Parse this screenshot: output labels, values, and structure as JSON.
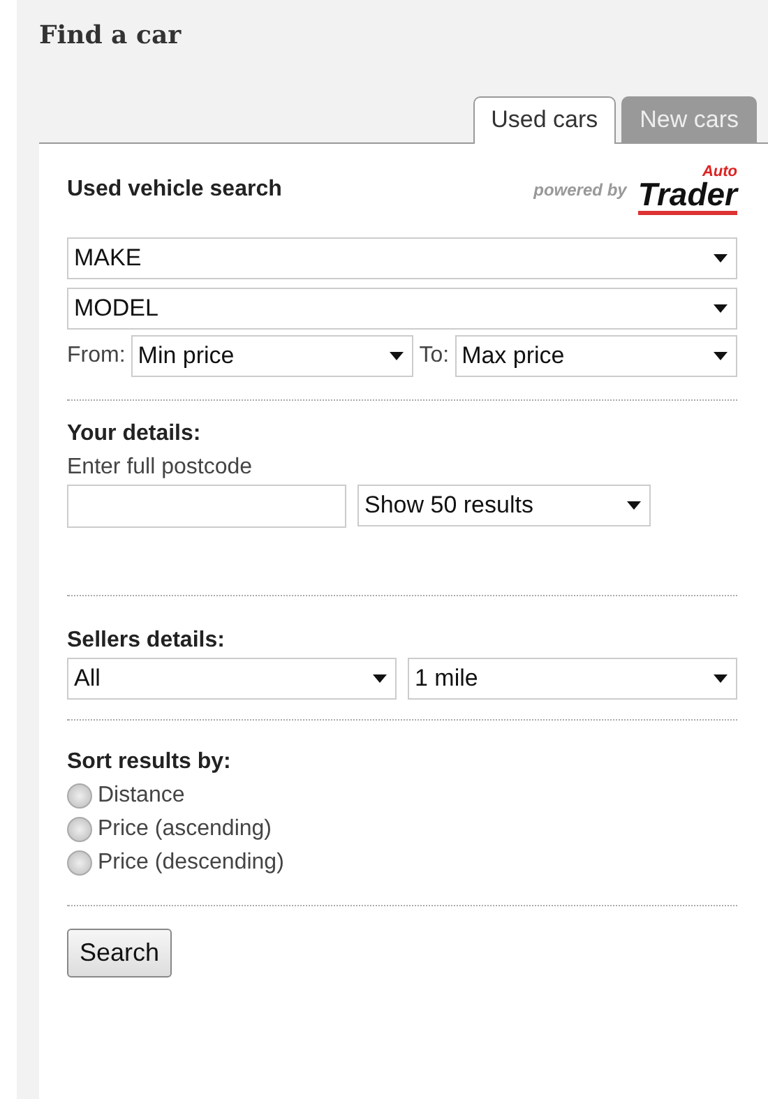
{
  "title": "Find a car",
  "tabs": [
    {
      "label": "Used cars",
      "selected": true
    },
    {
      "label": "New cars",
      "selected": false
    }
  ],
  "search": {
    "heading": "Used vehicle search",
    "powered_by": "powered by",
    "logo": {
      "top": "Auto",
      "main": "Trader"
    },
    "make": "MAKE",
    "model": "MODEL",
    "from_label": "From:",
    "min_price": "Min price",
    "to_label": "To:",
    "max_price": "Max price"
  },
  "your_details": {
    "heading": "Your details:",
    "postcode_label": "Enter full postcode",
    "results": "Show 50 results"
  },
  "sellers": {
    "heading": "Sellers details:",
    "seller_type": "All",
    "distance": "1 mile"
  },
  "sort": {
    "heading": "Sort results by:",
    "options": [
      {
        "label": "Distance",
        "selected": false
      },
      {
        "label": "Price (ascending)",
        "selected": false
      },
      {
        "label": "Price (descending)",
        "selected": false
      }
    ]
  },
  "button": "Search"
}
